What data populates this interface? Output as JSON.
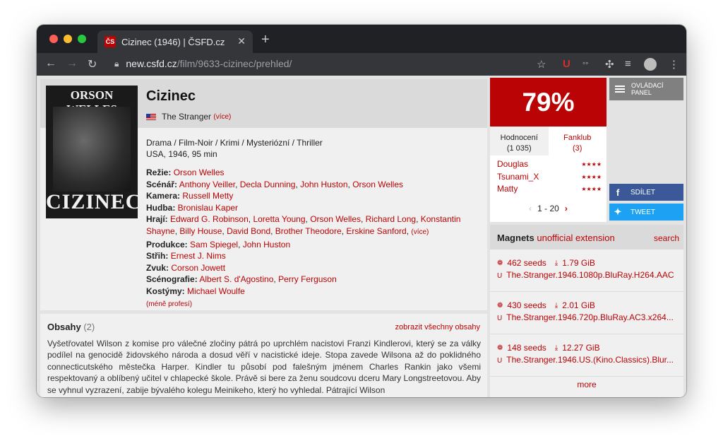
{
  "browser": {
    "tab_title": "Cizinec (1946) | ČSFD.cz",
    "favicon_text": "ČS",
    "url_host": "new.csfd.cz",
    "url_path": "/film/9633-cizinec/prehled/"
  },
  "film": {
    "title": "Cizinec",
    "original_title": "The Stranger",
    "more_link": "(více)",
    "genres": "Drama / Film-Noir / Krimi / Mysteriózní / Thriller",
    "origin": "USA, 1946, 95 min",
    "poster_top": "ORSON WELLES",
    "poster_bottom": "CIZINEC",
    "creators": {
      "directing_label": "Režie:",
      "directing": "Orson Welles",
      "screenplay_label": "Scénář:",
      "screenplay": [
        "Anthony Veiller",
        "Decla Dunning",
        "John Huston",
        "Orson Welles"
      ],
      "camera_label": "Kamera:",
      "camera": "Russell Metty",
      "music_label": "Hudba:",
      "music": "Bronislau Kaper",
      "cast_label": "Hrají:",
      "cast": [
        "Edward G. Robinson",
        "Loretta Young",
        "Orson Welles",
        "Richard Long",
        "Konstantin Shayne",
        "Billy House",
        "David Bond",
        "Brother Theodore",
        "Erskine Sanford"
      ],
      "cast_more": "(více)",
      "production_label": "Produkce:",
      "production": [
        "Sam Spiegel",
        "John Huston"
      ],
      "editing_label": "Střih:",
      "editing": "Ernest J. Nims",
      "sound_label": "Zvuk:",
      "sound": "Corson Jowett",
      "set_label": "Scénografie:",
      "set": [
        "Albert S. d'Agostino",
        "Perry Ferguson"
      ],
      "costume_label": "Kostýmy:",
      "costume": "Michael Woulfe",
      "less": "(méně profesí)"
    }
  },
  "plots": {
    "heading": "Obsahy",
    "count": "(2)",
    "show_all": "zobrazit všechny obsahy",
    "text": "Vyšetřovatel Wilson z komise pro válečné zločiny pátrá po uprchlém nacistovi Franzi Kindlerovi, který se za války podílel na genocidě židovského národa a dosud věří v nacistické ideje. Stopa zavede Wilsona až do poklidného connecticutského městečka Harper. Kindler tu působí pod falešným jménem Charles Rankin jako všemi respektovaný a oblíbený učitel v chlapecké škole. Právě si bere za ženu soudcovu dceru Mary Longstreetovou. Aby se vyhnul vyzrazení, zabije bývalého kolegu Meinikeho, který ho vyhledal. Pátrající Wilson"
  },
  "rating": {
    "score": "79%",
    "tab_ratings": "Hodnocení",
    "tab_ratings_count": "(1 035)",
    "tab_fanclub": "Fanklub",
    "tab_fanclub_count": "(3)",
    "users": [
      {
        "name": "Douglas",
        "stars": "★★★★"
      },
      {
        "name": "Tsunami_X",
        "stars": "★★★★"
      },
      {
        "name": "Matty",
        "stars": "★★★★"
      }
    ],
    "pager": "1 - 20"
  },
  "sidebar": {
    "panel_button": "OVLÁDACÍ PANEL",
    "share_fb": "SDÍLET",
    "share_tw": "TWEET"
  },
  "magnets": {
    "title": "Magnets",
    "subtitle": "unofficial extension",
    "search": "search",
    "items": [
      {
        "seeds": "462 seeds",
        "size": "1.79 GiB",
        "name": "The.Stranger.1946.1080p.BluRay.H264.AAC"
      },
      {
        "seeds": "430 seeds",
        "size": "2.01 GiB",
        "name": "The.Stranger.1946.720p.BluRay.AC3.x264..."
      },
      {
        "seeds": "148 seeds",
        "size": "12.27 GiB",
        "name": "The.Stranger.1946.US.(Kino.Classics).Blur..."
      }
    ],
    "more": "more"
  }
}
